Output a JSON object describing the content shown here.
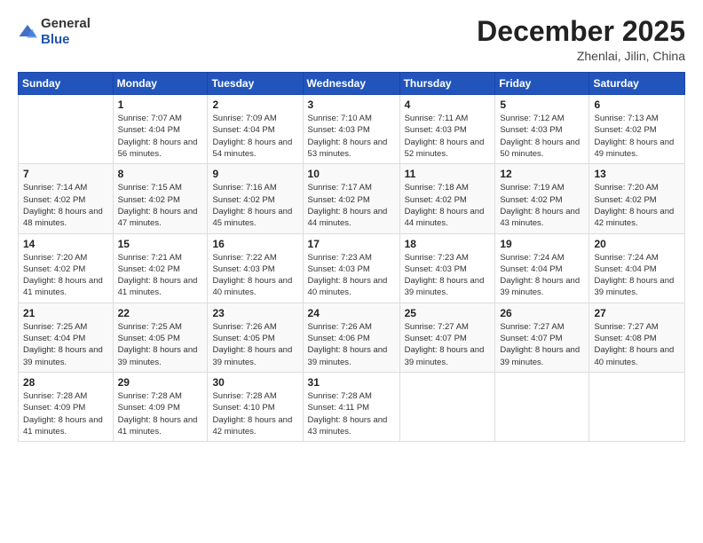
{
  "logo": {
    "text_general": "General",
    "text_blue": "Blue"
  },
  "title": {
    "month_year": "December 2025",
    "location": "Zhenlai, Jilin, China"
  },
  "weekdays": [
    "Sunday",
    "Monday",
    "Tuesday",
    "Wednesday",
    "Thursday",
    "Friday",
    "Saturday"
  ],
  "weeks": [
    [
      {
        "day": "",
        "sunrise": "",
        "sunset": "",
        "daylight": ""
      },
      {
        "day": "1",
        "sunrise": "Sunrise: 7:07 AM",
        "sunset": "Sunset: 4:04 PM",
        "daylight": "Daylight: 8 hours and 56 minutes."
      },
      {
        "day": "2",
        "sunrise": "Sunrise: 7:09 AM",
        "sunset": "Sunset: 4:04 PM",
        "daylight": "Daylight: 8 hours and 54 minutes."
      },
      {
        "day": "3",
        "sunrise": "Sunrise: 7:10 AM",
        "sunset": "Sunset: 4:03 PM",
        "daylight": "Daylight: 8 hours and 53 minutes."
      },
      {
        "day": "4",
        "sunrise": "Sunrise: 7:11 AM",
        "sunset": "Sunset: 4:03 PM",
        "daylight": "Daylight: 8 hours and 52 minutes."
      },
      {
        "day": "5",
        "sunrise": "Sunrise: 7:12 AM",
        "sunset": "Sunset: 4:03 PM",
        "daylight": "Daylight: 8 hours and 50 minutes."
      },
      {
        "day": "6",
        "sunrise": "Sunrise: 7:13 AM",
        "sunset": "Sunset: 4:02 PM",
        "daylight": "Daylight: 8 hours and 49 minutes."
      }
    ],
    [
      {
        "day": "7",
        "sunrise": "Sunrise: 7:14 AM",
        "sunset": "Sunset: 4:02 PM",
        "daylight": "Daylight: 8 hours and 48 minutes."
      },
      {
        "day": "8",
        "sunrise": "Sunrise: 7:15 AM",
        "sunset": "Sunset: 4:02 PM",
        "daylight": "Daylight: 8 hours and 47 minutes."
      },
      {
        "day": "9",
        "sunrise": "Sunrise: 7:16 AM",
        "sunset": "Sunset: 4:02 PM",
        "daylight": "Daylight: 8 hours and 45 minutes."
      },
      {
        "day": "10",
        "sunrise": "Sunrise: 7:17 AM",
        "sunset": "Sunset: 4:02 PM",
        "daylight": "Daylight: 8 hours and 44 minutes."
      },
      {
        "day": "11",
        "sunrise": "Sunrise: 7:18 AM",
        "sunset": "Sunset: 4:02 PM",
        "daylight": "Daylight: 8 hours and 44 minutes."
      },
      {
        "day": "12",
        "sunrise": "Sunrise: 7:19 AM",
        "sunset": "Sunset: 4:02 PM",
        "daylight": "Daylight: 8 hours and 43 minutes."
      },
      {
        "day": "13",
        "sunrise": "Sunrise: 7:20 AM",
        "sunset": "Sunset: 4:02 PM",
        "daylight": "Daylight: 8 hours and 42 minutes."
      }
    ],
    [
      {
        "day": "14",
        "sunrise": "Sunrise: 7:20 AM",
        "sunset": "Sunset: 4:02 PM",
        "daylight": "Daylight: 8 hours and 41 minutes."
      },
      {
        "day": "15",
        "sunrise": "Sunrise: 7:21 AM",
        "sunset": "Sunset: 4:02 PM",
        "daylight": "Daylight: 8 hours and 41 minutes."
      },
      {
        "day": "16",
        "sunrise": "Sunrise: 7:22 AM",
        "sunset": "Sunset: 4:03 PM",
        "daylight": "Daylight: 8 hours and 40 minutes."
      },
      {
        "day": "17",
        "sunrise": "Sunrise: 7:23 AM",
        "sunset": "Sunset: 4:03 PM",
        "daylight": "Daylight: 8 hours and 40 minutes."
      },
      {
        "day": "18",
        "sunrise": "Sunrise: 7:23 AM",
        "sunset": "Sunset: 4:03 PM",
        "daylight": "Daylight: 8 hours and 39 minutes."
      },
      {
        "day": "19",
        "sunrise": "Sunrise: 7:24 AM",
        "sunset": "Sunset: 4:04 PM",
        "daylight": "Daylight: 8 hours and 39 minutes."
      },
      {
        "day": "20",
        "sunrise": "Sunrise: 7:24 AM",
        "sunset": "Sunset: 4:04 PM",
        "daylight": "Daylight: 8 hours and 39 minutes."
      }
    ],
    [
      {
        "day": "21",
        "sunrise": "Sunrise: 7:25 AM",
        "sunset": "Sunset: 4:04 PM",
        "daylight": "Daylight: 8 hours and 39 minutes."
      },
      {
        "day": "22",
        "sunrise": "Sunrise: 7:25 AM",
        "sunset": "Sunset: 4:05 PM",
        "daylight": "Daylight: 8 hours and 39 minutes."
      },
      {
        "day": "23",
        "sunrise": "Sunrise: 7:26 AM",
        "sunset": "Sunset: 4:05 PM",
        "daylight": "Daylight: 8 hours and 39 minutes."
      },
      {
        "day": "24",
        "sunrise": "Sunrise: 7:26 AM",
        "sunset": "Sunset: 4:06 PM",
        "daylight": "Daylight: 8 hours and 39 minutes."
      },
      {
        "day": "25",
        "sunrise": "Sunrise: 7:27 AM",
        "sunset": "Sunset: 4:07 PM",
        "daylight": "Daylight: 8 hours and 39 minutes."
      },
      {
        "day": "26",
        "sunrise": "Sunrise: 7:27 AM",
        "sunset": "Sunset: 4:07 PM",
        "daylight": "Daylight: 8 hours and 39 minutes."
      },
      {
        "day": "27",
        "sunrise": "Sunrise: 7:27 AM",
        "sunset": "Sunset: 4:08 PM",
        "daylight": "Daylight: 8 hours and 40 minutes."
      }
    ],
    [
      {
        "day": "28",
        "sunrise": "Sunrise: 7:28 AM",
        "sunset": "Sunset: 4:09 PM",
        "daylight": "Daylight: 8 hours and 41 minutes."
      },
      {
        "day": "29",
        "sunrise": "Sunrise: 7:28 AM",
        "sunset": "Sunset: 4:09 PM",
        "daylight": "Daylight: 8 hours and 41 minutes."
      },
      {
        "day": "30",
        "sunrise": "Sunrise: 7:28 AM",
        "sunset": "Sunset: 4:10 PM",
        "daylight": "Daylight: 8 hours and 42 minutes."
      },
      {
        "day": "31",
        "sunrise": "Sunrise: 7:28 AM",
        "sunset": "Sunset: 4:11 PM",
        "daylight": "Daylight: 8 hours and 43 minutes."
      },
      {
        "day": "",
        "sunrise": "",
        "sunset": "",
        "daylight": ""
      },
      {
        "day": "",
        "sunrise": "",
        "sunset": "",
        "daylight": ""
      },
      {
        "day": "",
        "sunrise": "",
        "sunset": "",
        "daylight": ""
      }
    ]
  ]
}
